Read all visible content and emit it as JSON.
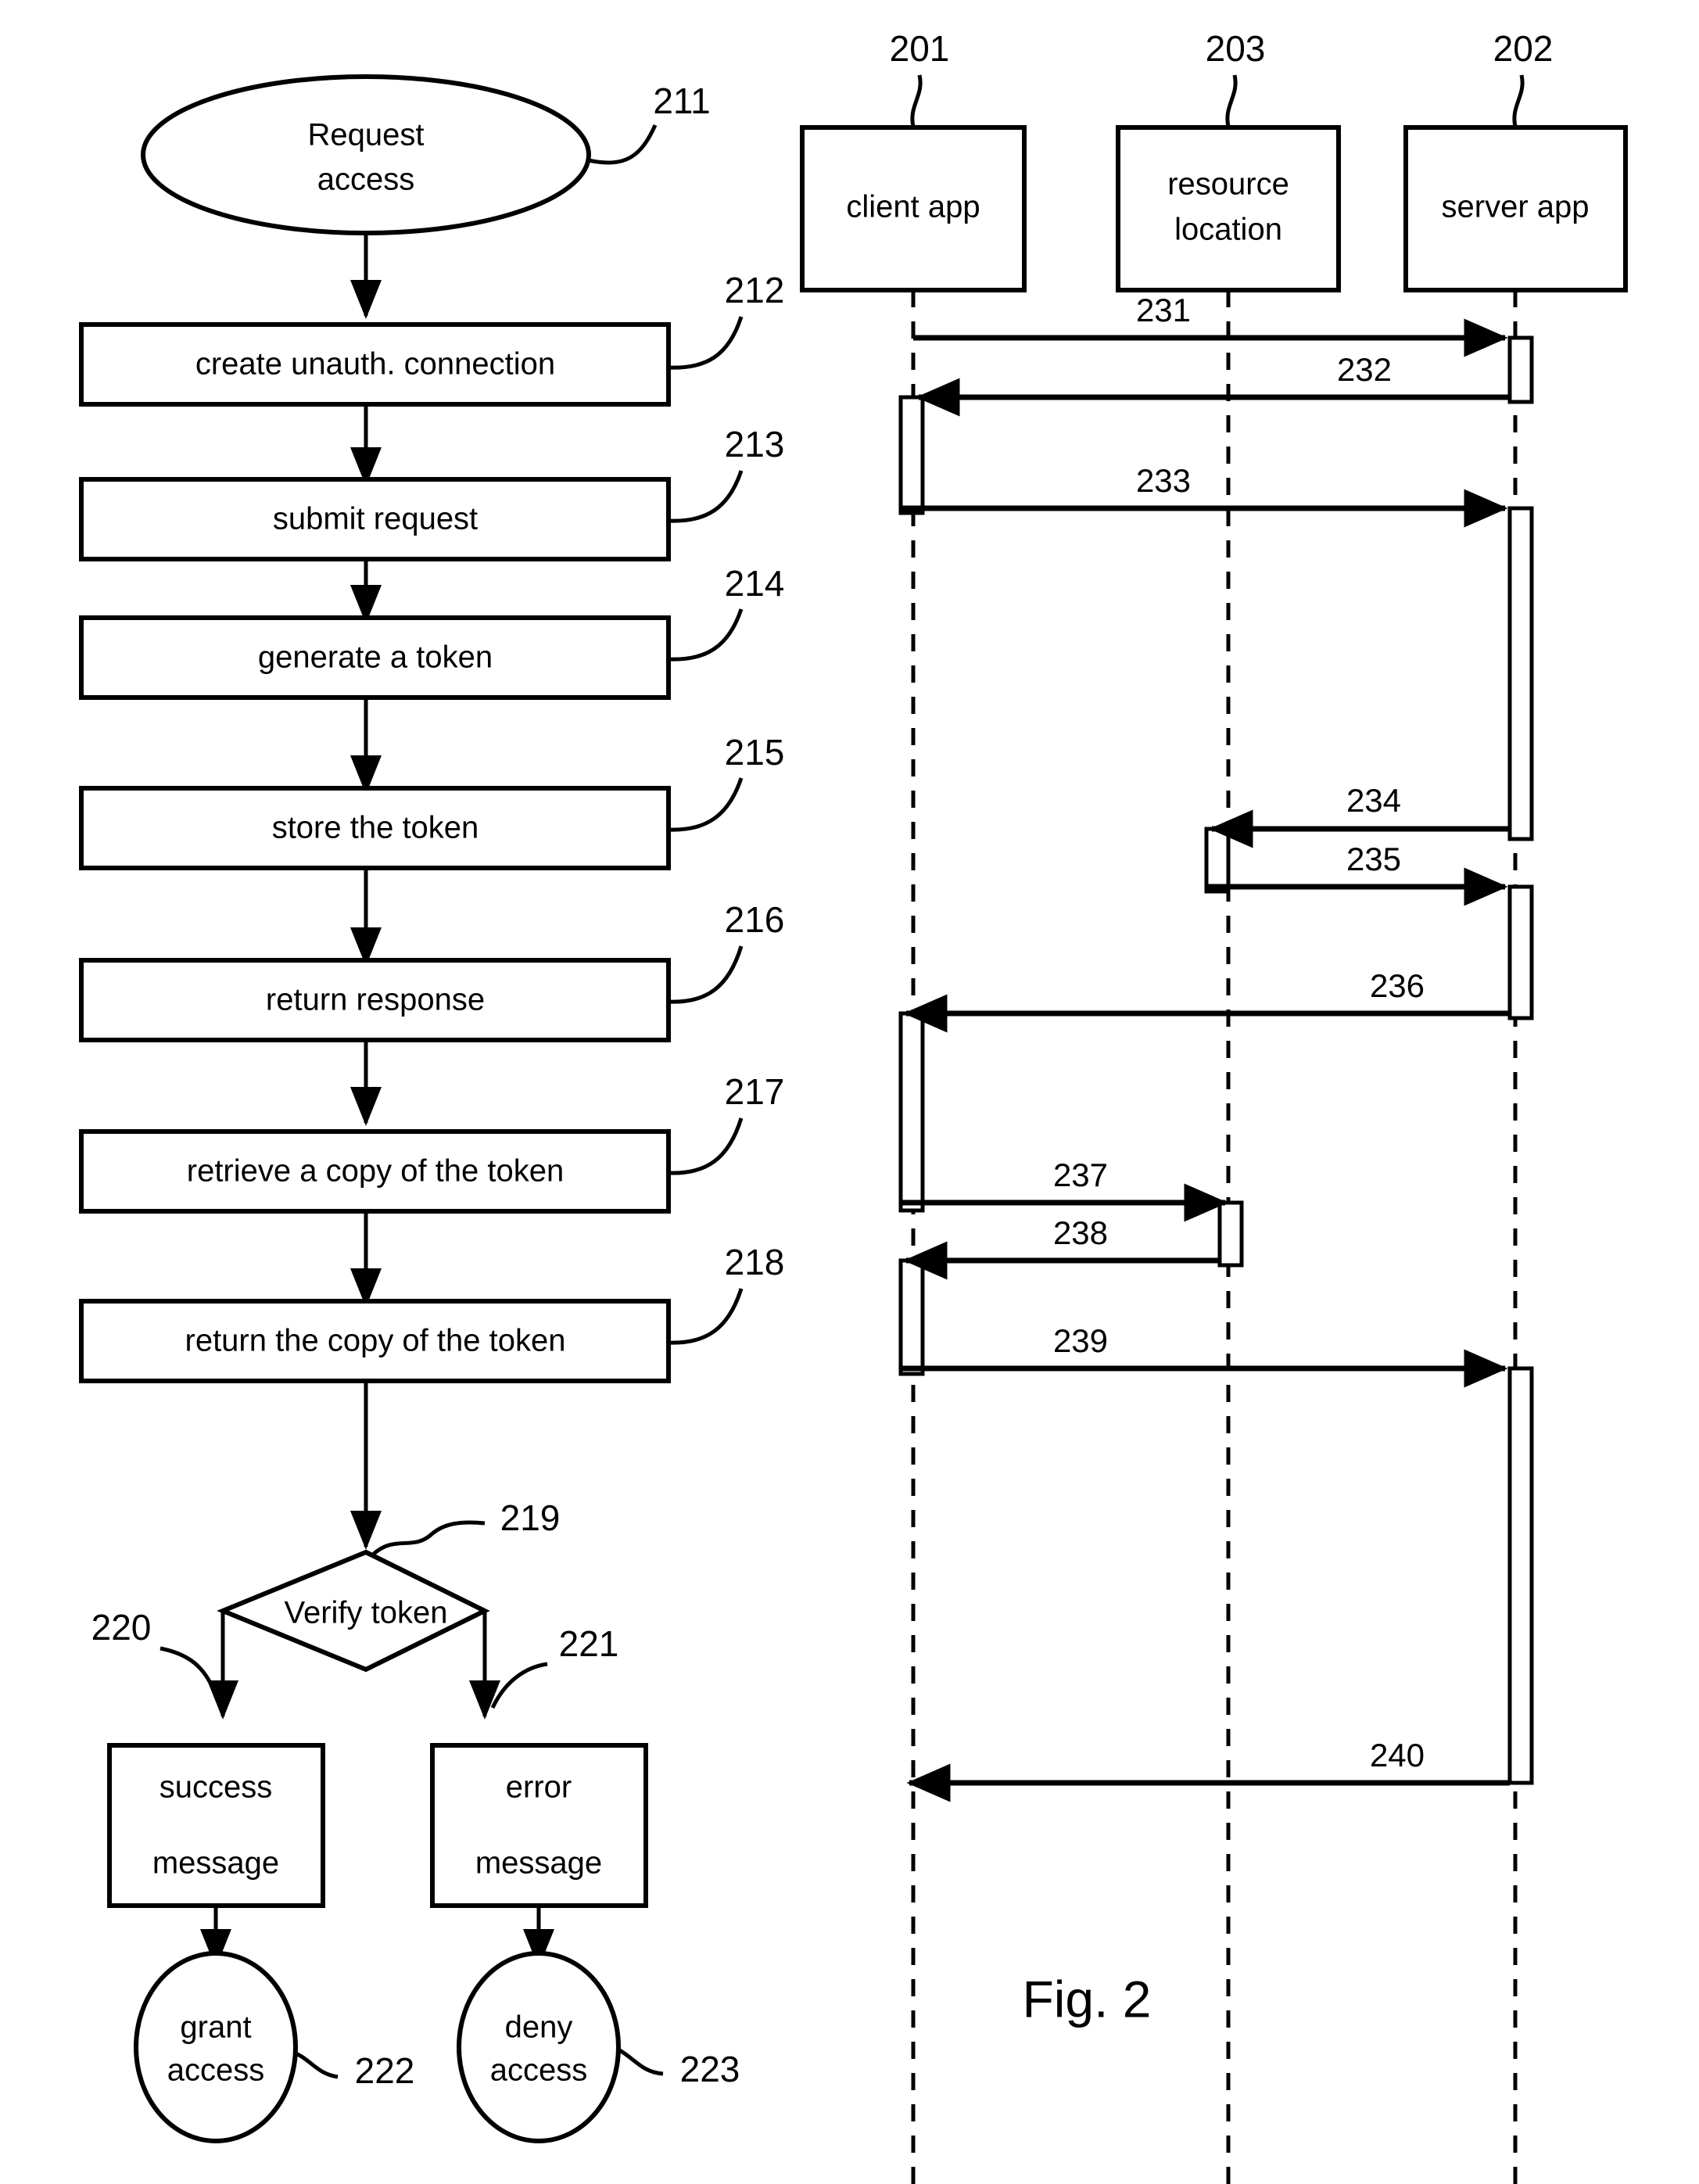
{
  "figure": {
    "caption": "Fig. 2"
  },
  "flowchart": {
    "start": {
      "label_line1": "Request",
      "label_line2": "access",
      "ref": "211"
    },
    "steps": [
      {
        "label": "create unauth. connection",
        "ref": "212"
      },
      {
        "label": "submit request",
        "ref": "213"
      },
      {
        "label": "generate a token",
        "ref": "214"
      },
      {
        "label": "store the token",
        "ref": "215"
      },
      {
        "label": "return response",
        "ref": "216"
      },
      {
        "label": "retrieve a copy of the token",
        "ref": "217"
      },
      {
        "label": "return the copy of the token",
        "ref": "218"
      }
    ],
    "decision": {
      "label": "Verify token",
      "ref": "219"
    },
    "outcomes": [
      {
        "label_line1": "success",
        "label_line2": "message",
        "ref": "220"
      },
      {
        "label_line1": "error",
        "label_line2": "message",
        "ref": "221"
      }
    ],
    "terminals": [
      {
        "label_line1": "grant",
        "label_line2": "access",
        "ref": "222"
      },
      {
        "label_line1": "deny",
        "label_line2": "access",
        "ref": "223"
      }
    ]
  },
  "sequence": {
    "participants": [
      {
        "label_line1": "client app",
        "label_line2": "",
        "ref": "201"
      },
      {
        "label_line1": "resource",
        "label_line2": "location",
        "ref": "203"
      },
      {
        "label_line1": "server app",
        "label_line2": "",
        "ref": "202"
      }
    ],
    "messages": [
      {
        "ref": "231",
        "from": "client app",
        "to": "server app",
        "direction": "right"
      },
      {
        "ref": "232",
        "from": "server app",
        "to": "client app",
        "direction": "left"
      },
      {
        "ref": "233",
        "from": "client app",
        "to": "server app",
        "direction": "right"
      },
      {
        "ref": "234",
        "from": "server app",
        "to": "resource location",
        "direction": "left"
      },
      {
        "ref": "235",
        "from": "resource location",
        "to": "server app",
        "direction": "right"
      },
      {
        "ref": "236",
        "from": "server app",
        "to": "client app",
        "direction": "left"
      },
      {
        "ref": "237",
        "from": "client app",
        "to": "resource location",
        "direction": "right"
      },
      {
        "ref": "238",
        "from": "resource location",
        "to": "client app",
        "direction": "left"
      },
      {
        "ref": "239",
        "from": "client app",
        "to": "server app",
        "direction": "right"
      },
      {
        "ref": "240",
        "from": "server app",
        "to": "client app",
        "direction": "left"
      }
    ]
  },
  "chart_data": {
    "type": "diagram",
    "title": "Fig. 2",
    "subtype": "flowchart + UML sequence diagram",
    "flow_nodes": [
      {
        "id": "211",
        "shape": "ellipse",
        "text": "Request access"
      },
      {
        "id": "212",
        "shape": "rect",
        "text": "create unauth. connection"
      },
      {
        "id": "213",
        "shape": "rect",
        "text": "submit request"
      },
      {
        "id": "214",
        "shape": "rect",
        "text": "generate a token"
      },
      {
        "id": "215",
        "shape": "rect",
        "text": "store the token"
      },
      {
        "id": "216",
        "shape": "rect",
        "text": "return response"
      },
      {
        "id": "217",
        "shape": "rect",
        "text": "retrieve a copy of the token"
      },
      {
        "id": "218",
        "shape": "rect",
        "text": "return the copy of the token"
      },
      {
        "id": "219",
        "shape": "diamond",
        "text": "Verify token"
      },
      {
        "id": "220",
        "shape": "rect",
        "text": "success message"
      },
      {
        "id": "221",
        "shape": "rect",
        "text": "error message"
      },
      {
        "id": "222",
        "shape": "ellipse",
        "text": "grant access"
      },
      {
        "id": "223",
        "shape": "ellipse",
        "text": "deny access"
      }
    ],
    "flow_edges": [
      [
        "211",
        "212"
      ],
      [
        "212",
        "213"
      ],
      [
        "213",
        "214"
      ],
      [
        "214",
        "215"
      ],
      [
        "215",
        "216"
      ],
      [
        "216",
        "217"
      ],
      [
        "217",
        "218"
      ],
      [
        "218",
        "219"
      ],
      [
        "219",
        "220"
      ],
      [
        "219",
        "221"
      ],
      [
        "220",
        "222"
      ],
      [
        "221",
        "223"
      ]
    ],
    "sequence_lifelines": [
      "client app",
      "resource location",
      "server app"
    ],
    "sequence_messages": [
      {
        "id": "231",
        "from": "client app",
        "to": "server app"
      },
      {
        "id": "232",
        "from": "server app",
        "to": "client app"
      },
      {
        "id": "233",
        "from": "client app",
        "to": "server app"
      },
      {
        "id": "234",
        "from": "server app",
        "to": "resource location"
      },
      {
        "id": "235",
        "from": "resource location",
        "to": "server app"
      },
      {
        "id": "236",
        "from": "server app",
        "to": "client app"
      },
      {
        "id": "237",
        "from": "client app",
        "to": "resource location"
      },
      {
        "id": "238",
        "from": "resource location",
        "to": "client app"
      },
      {
        "id": "239",
        "from": "client app",
        "to": "server app"
      },
      {
        "id": "240",
        "from": "server app",
        "to": "client app"
      }
    ]
  }
}
